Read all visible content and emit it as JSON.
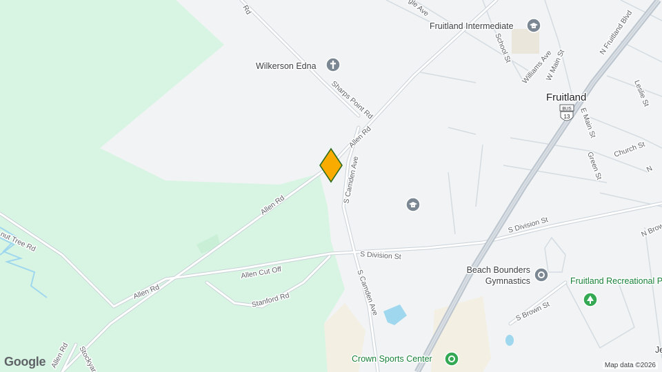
{
  "map": {
    "town": "Fruitland",
    "attribution": "Map data ©2026",
    "logo": "Google",
    "marker_icon": "orange-diamond-marker",
    "colors": {
      "background": "#f1f3f4",
      "forest": "#d8f5e3",
      "water": "#9fd7ee",
      "road": "#ffffff",
      "highway": "#c5cdd5",
      "marker": "#f9ab00",
      "park_pin": "#34a853",
      "poi_pin": "#7b8893"
    },
    "streets": {
      "rd_top": "Rd",
      "gle_ave": "gle Ave",
      "sharps_point_rd": "Sharps Point Rd",
      "allen_rd_upper": "Allen Rd",
      "allen_rd_mid": "Allen Rd",
      "allen_rd_lower": "Allen Rd",
      "allen_rd_bottom": "Allen Rd",
      "s_camden_ave_upper": "S Camden Ave",
      "s_camden_ave_lower": "S Camden Ave",
      "s_division_st_west": "S Division St",
      "s_division_st_east": "S Division St",
      "allen_cut_off": "Allen Cut Off",
      "stanford_rd": "Stanford Rd",
      "nut_tree_rd": "nut Tree Rd",
      "stockyard": "Stockyar",
      "school_st": "School St",
      "williams_ave": "Williams Ave",
      "w_main_st": "W Main St",
      "e_main_st": "E Main St",
      "green_st": "Green St",
      "church_st": "Church St",
      "leslie_st": "Leslie St",
      "n_fruitland_blvd": "N Fruitland Blvd",
      "n_brown": "N Brown",
      "s_brown_st": "S Brown St",
      "n_edge": "N"
    },
    "pois": {
      "fruitland_intermediate": "Fruitland Intermediate",
      "wilkerson_edna": "Wilkerson Edna",
      "beach_bounders_line1": "Beach Bounders",
      "beach_bounders_line2": "Gymnastics",
      "fruitland_rec_park": "Fruitland Recreational Park",
      "crown_sports_center": "Crown Sports Center",
      "jem": "Je"
    },
    "shield": {
      "top": "BUS",
      "number": "13"
    }
  }
}
